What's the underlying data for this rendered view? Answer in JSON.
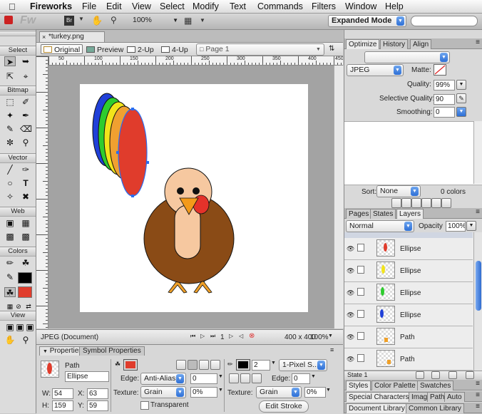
{
  "menubar": {
    "apple": "",
    "items": [
      "Fireworks",
      "File",
      "Edit",
      "View",
      "Select",
      "Modify",
      "Text",
      "Commands",
      "Filters",
      "Window",
      "Help"
    ]
  },
  "appbar": {
    "logo": "Fw",
    "br": "Br",
    "zoom": "100%",
    "mode": "Expanded Mode"
  },
  "tools": {
    "sections": [
      "Select",
      "Bitmap",
      "Vector",
      "Web",
      "Colors",
      "View"
    ]
  },
  "document": {
    "tab": "*turkey.png",
    "views": [
      "Original",
      "Preview",
      "2-Up",
      "4-Up"
    ],
    "page": "Page 1",
    "ruler_ticks": [
      "50",
      "100",
      "150",
      "200",
      "250",
      "300",
      "350",
      "400",
      "450"
    ],
    "status_left": "JPEG (Document)",
    "frame": "1",
    "size": "400 x 400",
    "zoom": "100%"
  },
  "properties": {
    "tabs": [
      "Properties",
      "Symbol Properties"
    ],
    "type": "Path",
    "name": "Ellipse",
    "w_label": "W:",
    "w": "54",
    "x_label": "X:",
    "x": "63",
    "h_label": "H:",
    "h": "159",
    "y_label": "Y:",
    "y": "59",
    "edge_label": "Edge:",
    "edge": "Anti-Alias",
    "edge_val": "0",
    "texture_label": "Texture:",
    "texture": "Grain",
    "texture_pct": "0%",
    "transparent": "Transparent",
    "stroke_size": "2",
    "stroke_type": "1-Pixel S...",
    "stroke_edge_label": "Edge:",
    "stroke_edge": "0",
    "stroke_texture_label": "Texture:",
    "stroke_texture": "Grain",
    "stroke_texture_pct": "0%",
    "edit_stroke": "Edit Stroke",
    "fill_color": "#e03c2c",
    "stroke_color": "#000000"
  },
  "optimize": {
    "tabs": [
      "Optimize",
      "History",
      "Align"
    ],
    "format": "JPEG",
    "matte_label": "Matte:",
    "quality_label": "Quality:",
    "quality": "99%",
    "selective_label": "Selective Quality:",
    "selective": "90",
    "smoothing_label": "Smoothing:",
    "smoothing": "0",
    "sort_label": "Sort:",
    "sort": "None",
    "colors": "0 colors"
  },
  "layers": {
    "tabs": [
      "Pages",
      "States",
      "Layers"
    ],
    "blend": "Normal",
    "opacity_label": "Opacity",
    "opacity": "100%",
    "rows": [
      "Ellipse",
      "Ellipse",
      "Ellipse",
      "Ellipse",
      "Path",
      "Path"
    ],
    "state": "State 1"
  },
  "bottom_panels": {
    "row1": [
      "Styles",
      "Color Palette",
      "Swatches"
    ],
    "row2": [
      "Special Characters",
      "Imag",
      "Path",
      "Auto"
    ],
    "row3": [
      "Document Library",
      "Common Library"
    ]
  },
  "colors": {
    "feather_blue": "#2040d8",
    "feather_green": "#2ecc2e",
    "feather_yellow": "#f2e41a",
    "feather_orange": "#f0a030",
    "feather_red": "#e03c2c",
    "body_brown": "#8a4b16",
    "face_peach": "#f6c8a0",
    "beak_orange": "#f39a1a",
    "wattle_red": "#e4322a",
    "feet_orange": "#f0a028"
  }
}
